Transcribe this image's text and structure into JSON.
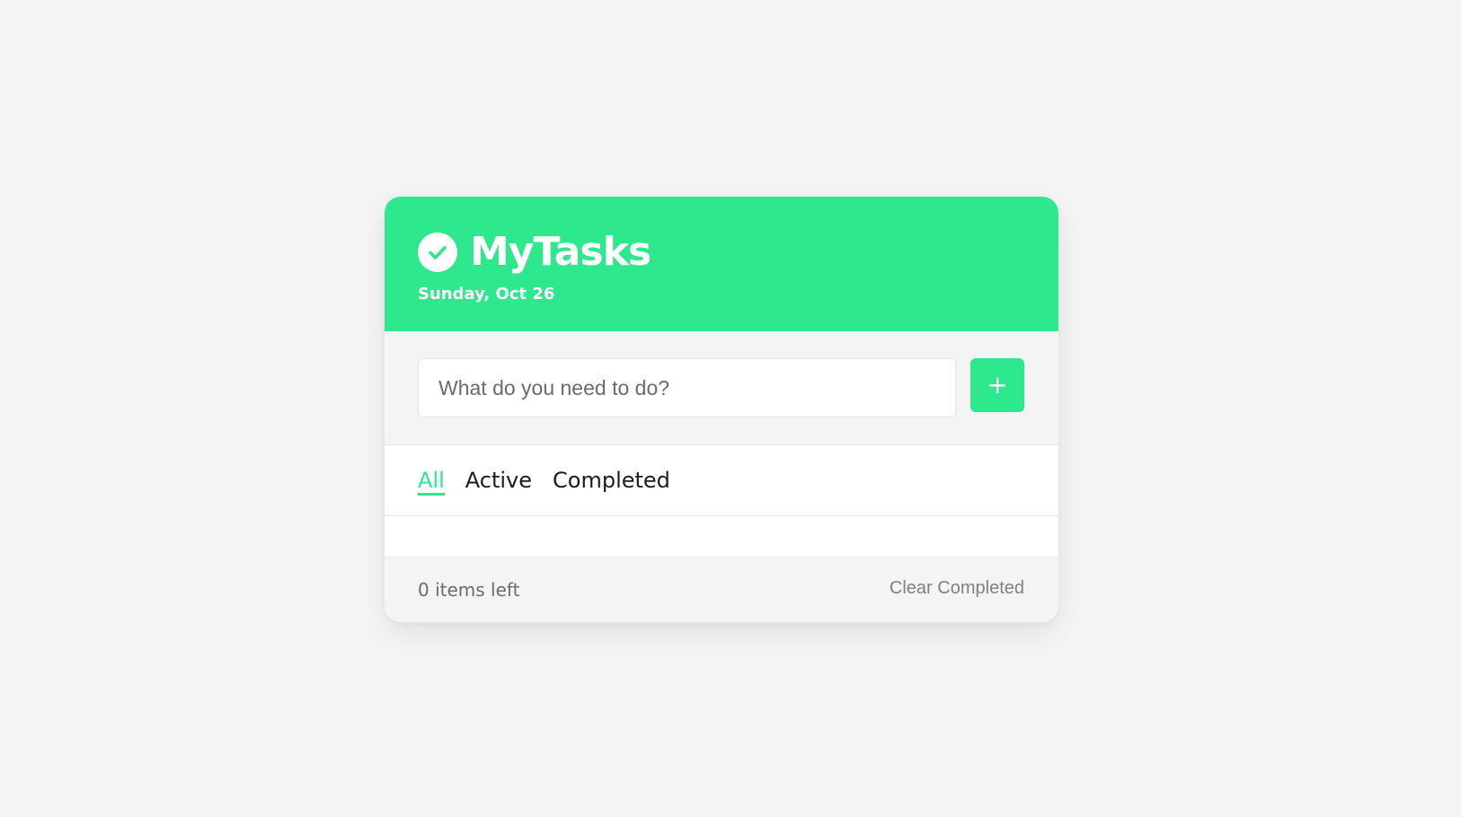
{
  "header": {
    "title": "MyTasks",
    "date": "Sunday, Oct 26",
    "icon": "check-circle-icon"
  },
  "new_task": {
    "placeholder": "What do you need to do?",
    "value": "",
    "add_label": "+"
  },
  "filters": {
    "tabs": [
      {
        "label": "All",
        "active": true
      },
      {
        "label": "Active",
        "active": false
      },
      {
        "label": "Completed",
        "active": false
      }
    ]
  },
  "tasks": [],
  "footer": {
    "items_left": "0 items left",
    "clear_label": "Clear Completed"
  },
  "colors": {
    "accent": "#2de88d",
    "background": "#f4f4f4",
    "card": "#ffffff"
  }
}
